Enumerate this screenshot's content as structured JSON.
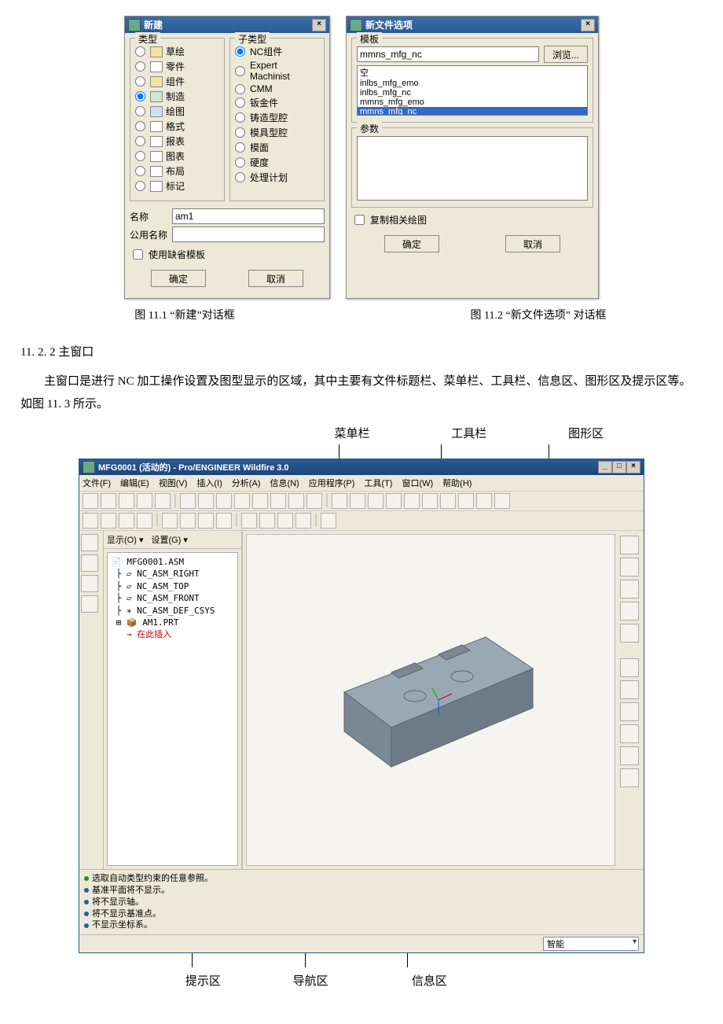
{
  "dlg_new": {
    "title": "新建",
    "group_type": "类型",
    "group_subtype": "子类型",
    "types": [
      "草绘",
      "零件",
      "组件",
      "制造",
      "绘图",
      "格式",
      "报表",
      "图表",
      "布局",
      "标记"
    ],
    "type_selected_index": 3,
    "subtypes": [
      "NC组件",
      "Expert Machinist",
      "CMM",
      "钣金件",
      "铸造型腔",
      "模具型腔",
      "模面",
      "硬度",
      "处理计划"
    ],
    "subtype_selected_index": 0,
    "name_label": "名称",
    "name_value": "am1",
    "common_name_label": "公用名称",
    "common_name_value": "",
    "use_default_template": "使用缺省模板",
    "ok": "确定",
    "cancel": "取消"
  },
  "dlg_opts": {
    "title": "新文件选项",
    "group_template": "模板",
    "template_value": "mmns_mfg_nc",
    "browse": "浏览...",
    "templates": [
      "空",
      "inlbs_mfg_emo",
      "inlbs_mfg_nc",
      "mmns_mfg_emo",
      "mmns_mfg_nc"
    ],
    "selected_template_index": 4,
    "group_params": "参数",
    "copy_related": "复制相关绘图",
    "ok": "确定",
    "cancel": "取消"
  },
  "caption_left": "图 11.1  “新建”对话框",
  "caption_right": "图 11.2 “新文件选项” 对话框",
  "section_heading": "11. 2. 2 主窗口",
  "paragraph": "主窗口是进行 NC 加工操作设置及图型显示的区域，其中主要有文件标题栏、菜单栏、工具栏、信息区、图形区及提示区等。如图 11. 3 所示。",
  "annot_top": {
    "menu": "菜单栏",
    "toolbar": "工具栏",
    "graphics": "图形区"
  },
  "annot_bot": {
    "hint": "提示区",
    "nav": "导航区",
    "info": "信息区"
  },
  "mainwin": {
    "title": "MFG0001 (活动的) - Pro/ENGINEER Wildfire 3.0",
    "menus": [
      "文件(F)",
      "编辑(E)",
      "视图(V)",
      "插入(I)",
      "分析(A)",
      "信息(N)",
      "应用程序(P)",
      "工具(T)",
      "窗口(W)",
      "帮助(H)"
    ],
    "nav_tabs_header": {
      "show": "显示(O) ▾",
      "set": "设置(G) ▾"
    },
    "tree_root": "MFG0001.ASM",
    "tree_items": [
      "NC_ASM_RIGHT",
      "NC_ASM_TOP",
      "NC_ASM_FRONT",
      "NC_ASM_DEF_CSYS",
      "AM1.PRT"
    ],
    "tree_insert": "→ 在此插入",
    "messages": [
      "选取自动类型约束的任意参照。",
      "基准平面将不显示。",
      "将不显示轴。",
      "将不显示基准点。",
      "不显示坐标系。"
    ],
    "status_label": "智能"
  }
}
